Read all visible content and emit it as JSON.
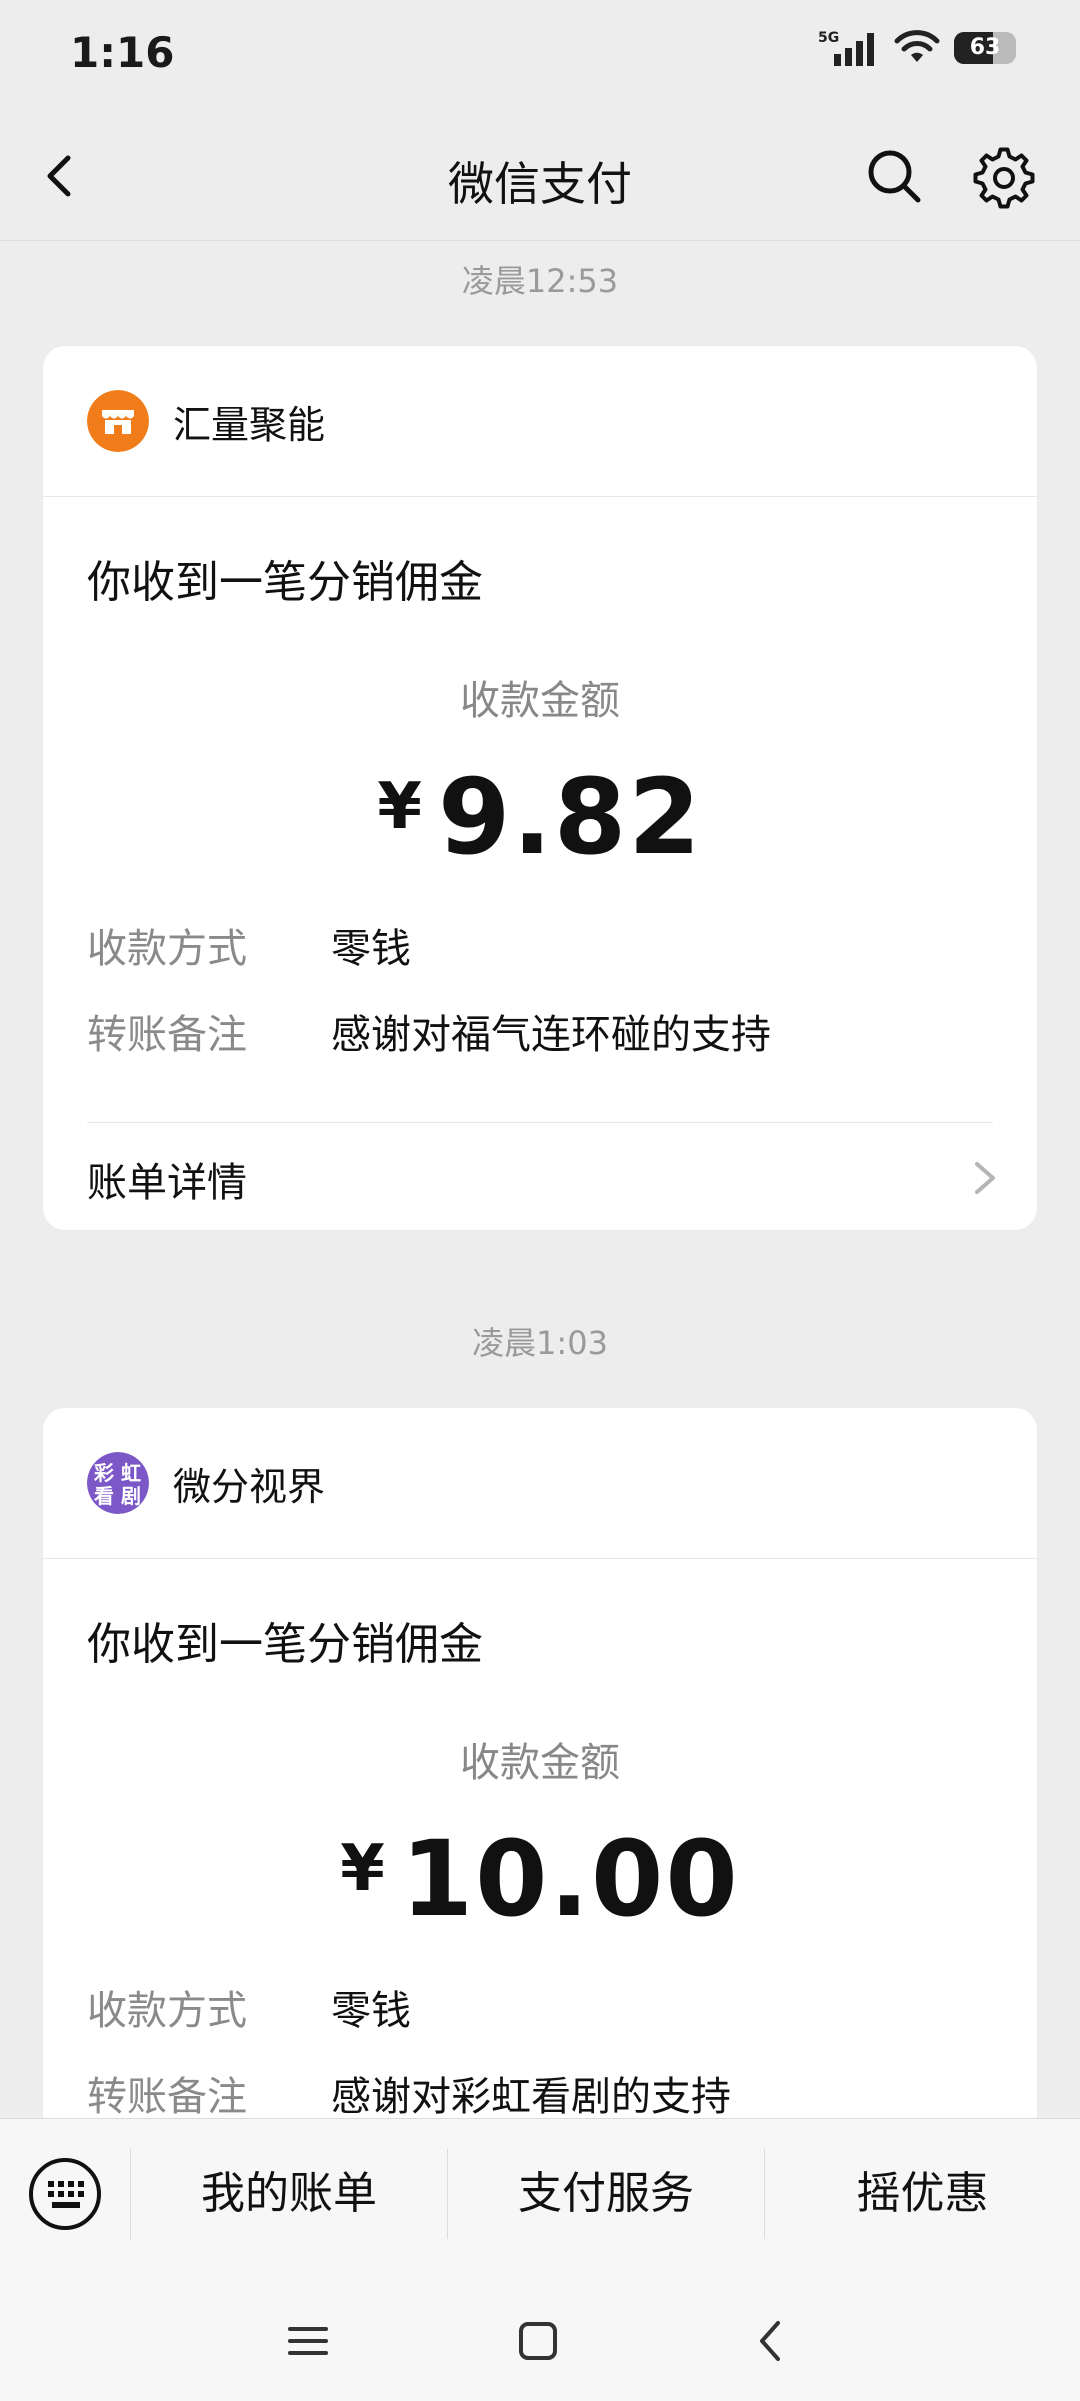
{
  "status": {
    "time": "1:16",
    "network": "5G",
    "battery": "63",
    "battery_fraction": 0.63
  },
  "nav": {
    "title": "微信支付"
  },
  "messages": [
    {
      "timestamp": "凌晨12:53",
      "merchant": "汇量聚能",
      "title": "你收到一笔分销佣金",
      "amount_label": "收款金额",
      "currency": "¥",
      "amount": "9.82",
      "method_label": "收款方式",
      "method": "零钱",
      "note_label": "转账备注",
      "note": "感谢对福气连环碰的支持",
      "detail_label": "账单详情",
      "icon_color": "#f07d1a"
    },
    {
      "timestamp": "凌晨1:03",
      "merchant": "微分视界",
      "merchant_icon_text": [
        "彩",
        "虹",
        "看",
        "剧"
      ],
      "title": "你收到一笔分销佣金",
      "amount_label": "收款金额",
      "currency": "¥",
      "amount": "10.00",
      "method_label": "收款方式",
      "method": "零钱",
      "note_label": "转账备注",
      "note": "感谢对彩虹看剧的支持",
      "icon_color": "#7b57c8"
    }
  ],
  "bottom_tabs": [
    "我的账单",
    "支付服务",
    "摇优惠"
  ],
  "icons": {
    "back": "chevron-left-icon",
    "search": "search-icon",
    "settings": "gear-icon",
    "keyboard": "keyboard-icon",
    "sys_menu": "menu-icon",
    "sys_home": "home-square-icon",
    "sys_back": "back-triangle-icon"
  }
}
